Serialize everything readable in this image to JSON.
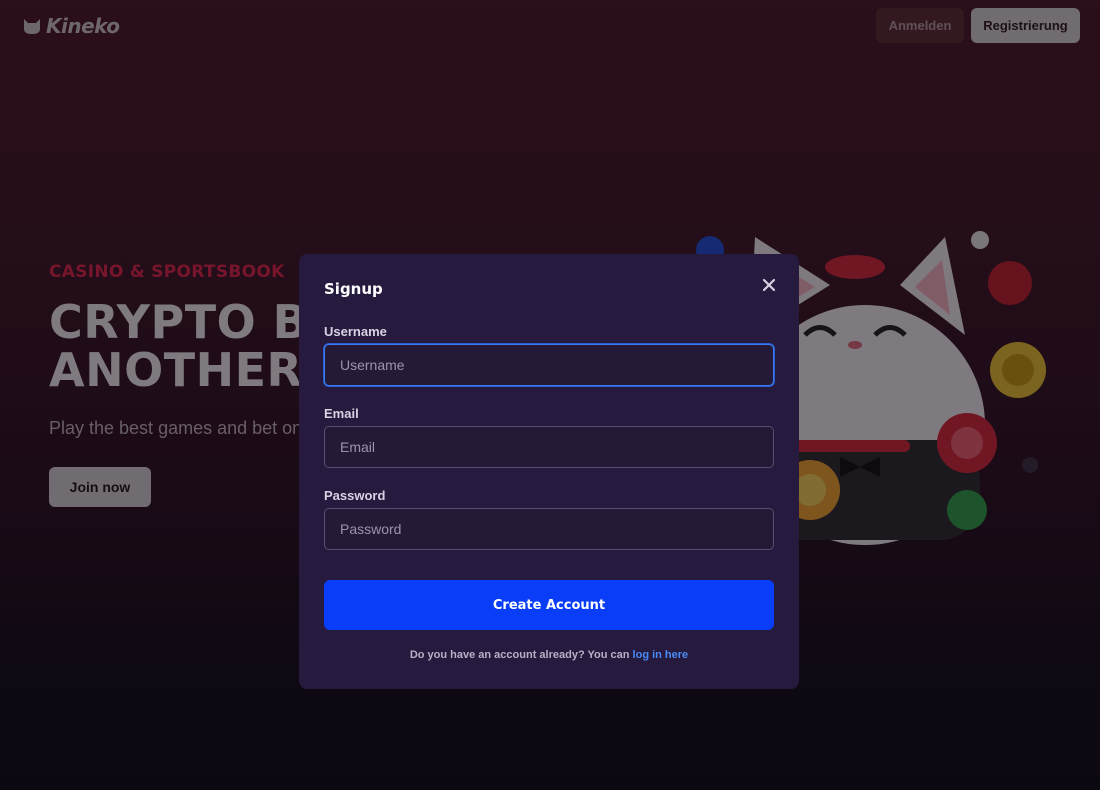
{
  "header": {
    "logo_text": "Kineko",
    "login_label": "Anmelden",
    "register_label": "Registrierung"
  },
  "hero": {
    "eyebrow": "CASINO & SPORTSBOOK",
    "title_line1": "CRYPTO BE",
    "title_line2": "ANOTHER",
    "subtitle": "Play the best games and bet on",
    "join_label": "Join now"
  },
  "modal": {
    "title": "Signup",
    "username": {
      "label": "Username",
      "placeholder": "Username",
      "value": ""
    },
    "email": {
      "label": "Email",
      "placeholder": "Email",
      "value": ""
    },
    "password": {
      "label": "Password",
      "placeholder": "Password",
      "value": ""
    },
    "submit_label": "Create Account",
    "footer_prefix": "Do you have an account already? You can ",
    "footer_link": "log in here"
  },
  "colors": {
    "accent": "#0a3df7",
    "link": "#4a8bf5",
    "modal_bg": "#261a3e",
    "hero_red": "#e0254a"
  }
}
